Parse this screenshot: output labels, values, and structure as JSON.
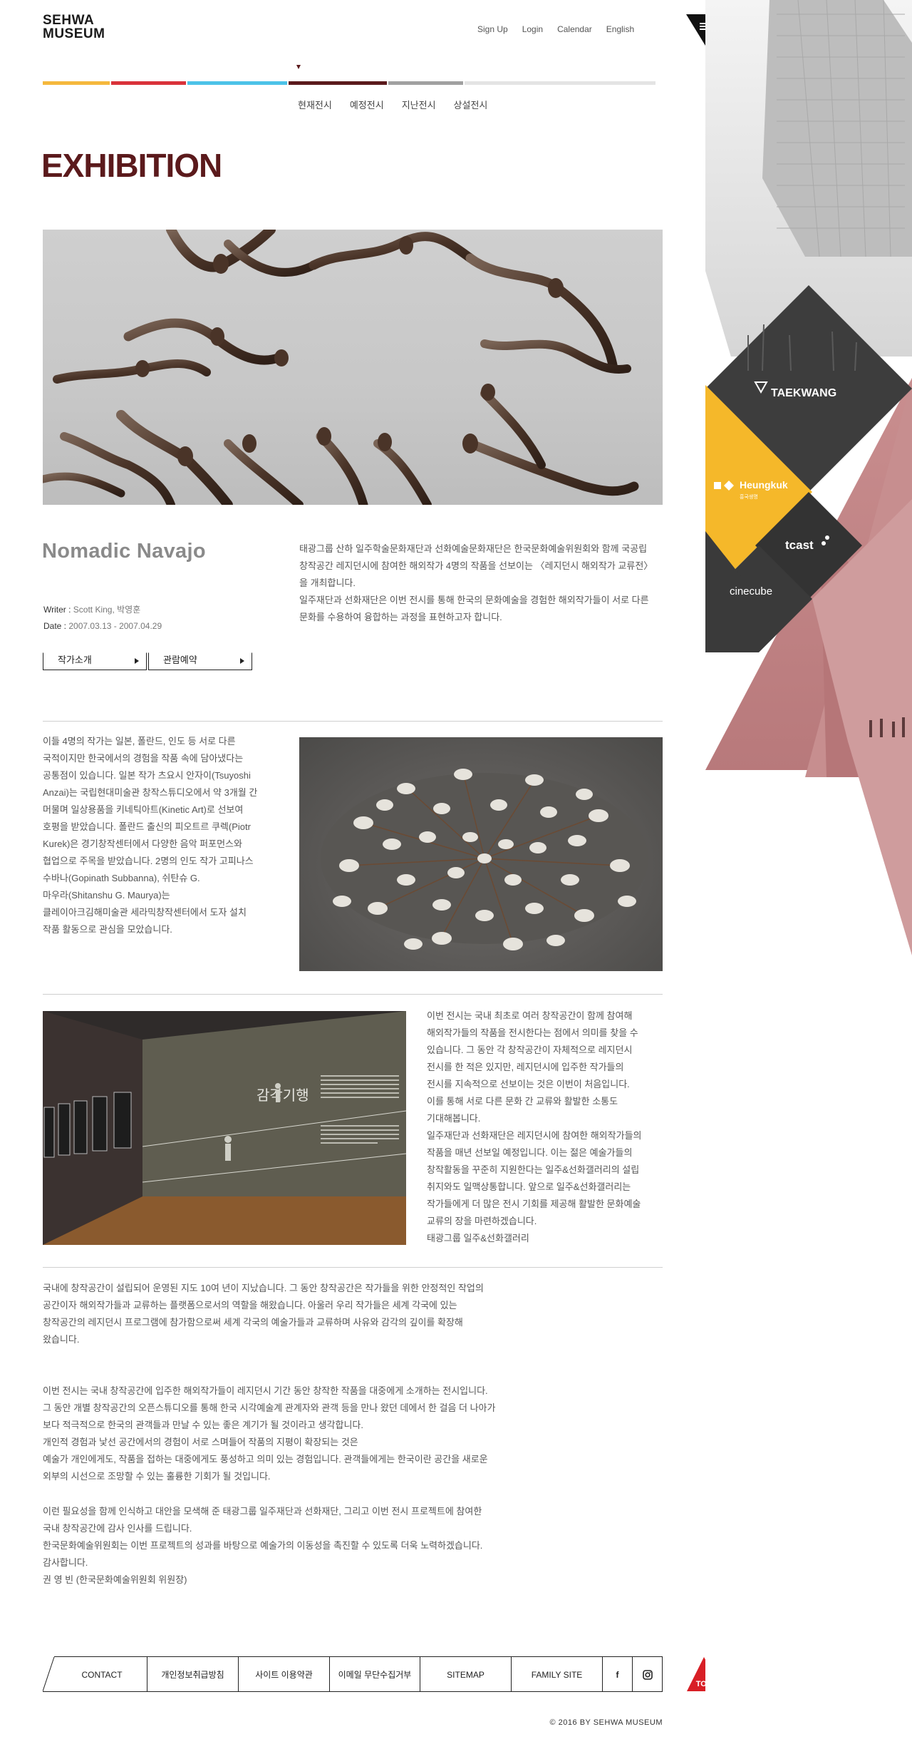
{
  "header": {
    "logo_line1": "SEHWA",
    "logo_line2": "MUSEUM",
    "links": [
      "Sign Up",
      "Login",
      "Calendar",
      "English"
    ]
  },
  "colors": {
    "bar": [
      "#f5b83d",
      "#d9323a",
      "#4cc2e8",
      "#5b1a1c",
      "#a0a0a0",
      "#e4e4e4"
    ],
    "accent": "#5b1a1c",
    "brand_yellow": "#f5b82a"
  },
  "subnav": [
    "현재전시",
    "예정전시",
    "지난전시",
    "상설전시"
  ],
  "page_title": "EXHIBITION",
  "exhibition": {
    "title": "Nomadic Navajo",
    "writer_label": "Writer : ",
    "writer": "Scott King, 박영훈",
    "date_label": "Date : ",
    "date": "2007.03.13 - 2007.04.29",
    "btn_artist": "작가소개",
    "btn_reserve": "관람예약",
    "description": [
      "태광그룹 산하 일주학술문화재단과 선화예술문화재단은 한국문화예술위원회와 함께 국공립",
      "창작공간 레지던시에 참여한 해외작가 4명의 작품을 선보이는 〈레지던시 해외작가 교류전〉",
      "을 개최합니다.",
      "일주재단과 선화재단은 이번 전시를 통해 한국의 문화예술을 경험한 해외작가들이 서로 다른",
      "문화를 수용하여 융합하는 과정을 표현하고자 합니다."
    ]
  },
  "section2": [
    "이들 4명의 작가는 일본, 폴란드, 인도 등 서로 다른",
    "국적이지만 한국에서의 경험을 작품 속에 담아냈다는",
    "공통점이 있습니다. 일본 작가 츠요시 안자이(Tsuyoshi",
    "Anzai)는 국립현대미술관 창작스튜디오에서 약 3개월 간",
    "머물며 일상용품을 키네틱아트(Kinetic Art)로 선보여",
    "호평을 받았습니다. 폴란드 출신의 피오트르 쿠렉(Piotr",
    "Kurek)은 경기창작센터에서 다양한 음악 퍼포먼스와",
    "협업으로 주목을 받았습니다. 2명의 인도 작가 고피나스",
    "수바나(Gopinath Subbanna), 쉬탄슈 G.",
    "마우라(Shitanshu G. Maurya)는",
    "클레이아크김해미술관 세라믹창작센터에서 도자 설치",
    "작품 활동으로 관심을 모았습니다."
  ],
  "section3": [
    "이번 전시는 국내 최초로 여러 창작공간이 함께 참여해",
    "해외작가들의 작품을 전시한다는 점에서 의미를 찾을 수",
    "있습니다. 그 동안 각 창작공간이 자체적으로 레지던시",
    "전시를 한 적은 있지만, 레지던시에 입주한 작가들의",
    "전시를 지속적으로 선보이는 것은 이번이 처음입니다.",
    "이를 통해 서로 다른 문화 간 교류와 활발한 소통도",
    "기대해봅니다.",
    "일주재단과 선화재단은 레지던시에 참여한 해외작가들의",
    "작품을 매년 선보일 예정입니다. 이는 젊은 예술가들의",
    "창작활동을 꾸준히 지원한다는 일주&선화갤러리의 설립",
    "취지와도 일맥상통합니다. 앞으로 일주&선화갤러리는",
    "작가들에게 더 많은 전시 기회를 제공해 활발한 문화예술",
    "교류의 장을 마련하겠습니다.",
    "태광그룹 일주&선화갤러리"
  ],
  "img3_sign": "감각기행",
  "section4a": [
    "국내에 창작공간이 설립되어 운영된 지도 10여 년이 지났습니다. 그 동안 창작공간은 작가들을 위한 안정적인 작업의",
    "공간이자 해외작가들과 교류하는 플랫폼으로서의 역할을 해왔습니다. 아울러 우리 작가들은 세계 각국에 있는",
    "창작공간의 레지던시 프로그램에 참가함으로써 세계 각국의 예술가들과 교류하며 사유와 감각의 깊이를 확장해",
    "왔습니다."
  ],
  "section4b": [
    "이번 전시는 국내 창작공간에 입주한 해외작가들이 레지던시 기간 동안 창작한 작품을 대중에게 소개하는 전시입니다.",
    "그 동안 개별 창작공간의 오픈스튜디오를 통해 한국 시각예술계 관계자와 관객 등을 만나 왔던 데에서 한 걸음 더 나아가",
    "보다 적극적으로 한국의 관객들과 만날 수 있는 좋은 계기가 될 것이라고 생각합니다.",
    "개인적 경험과 낯선 공간에서의 경험이 서로 스며들어 작품의 지평이 확장되는 것은",
    "예술가 개인에게도, 작품을 접하는 대중에게도 풍성하고 의미 있는 경험입니다. 관객들에게는 한국이란 공간을 새로운",
    "외부의 시선으로 조망할 수 있는 훌륭한 기회가 될 것입니다."
  ],
  "section4c": [
    "이런 필요성을 함께 인식하고 대안을 모색해 준 태광그룹 일주재단과 선화재단, 그리고 이번 전시 프로젝트에 참여한",
    "국내 창작공간에 감사 인사를 드립니다.",
    "한국문화예술위원회는 이번 프로젝트의 성과를 바탕으로 예술가의 이동성을 촉진할 수 있도록 더욱 노력하겠습니다.",
    "감사합니다.",
    "권 영 빈 (한국문화예술위원회 위원장)"
  ],
  "footer": {
    "items": [
      "CONTACT",
      "개인정보취급방침",
      "사이트 이용약관",
      "이메일 무단수집거부",
      "SITEMAP",
      "FAMILY SITE"
    ],
    "facebook_icon": "f",
    "instagram_icon": "instagram-icon",
    "top": "TOP",
    "copyright": "© 2016 BY SEHWA MUSEUM"
  },
  "family": {
    "taekwang": "TAEKWANG",
    "heungkuk": "Heungkuk",
    "heungkuk_sub": "흥국생명",
    "tcast": "tcast",
    "cinecube": "cinecube"
  }
}
